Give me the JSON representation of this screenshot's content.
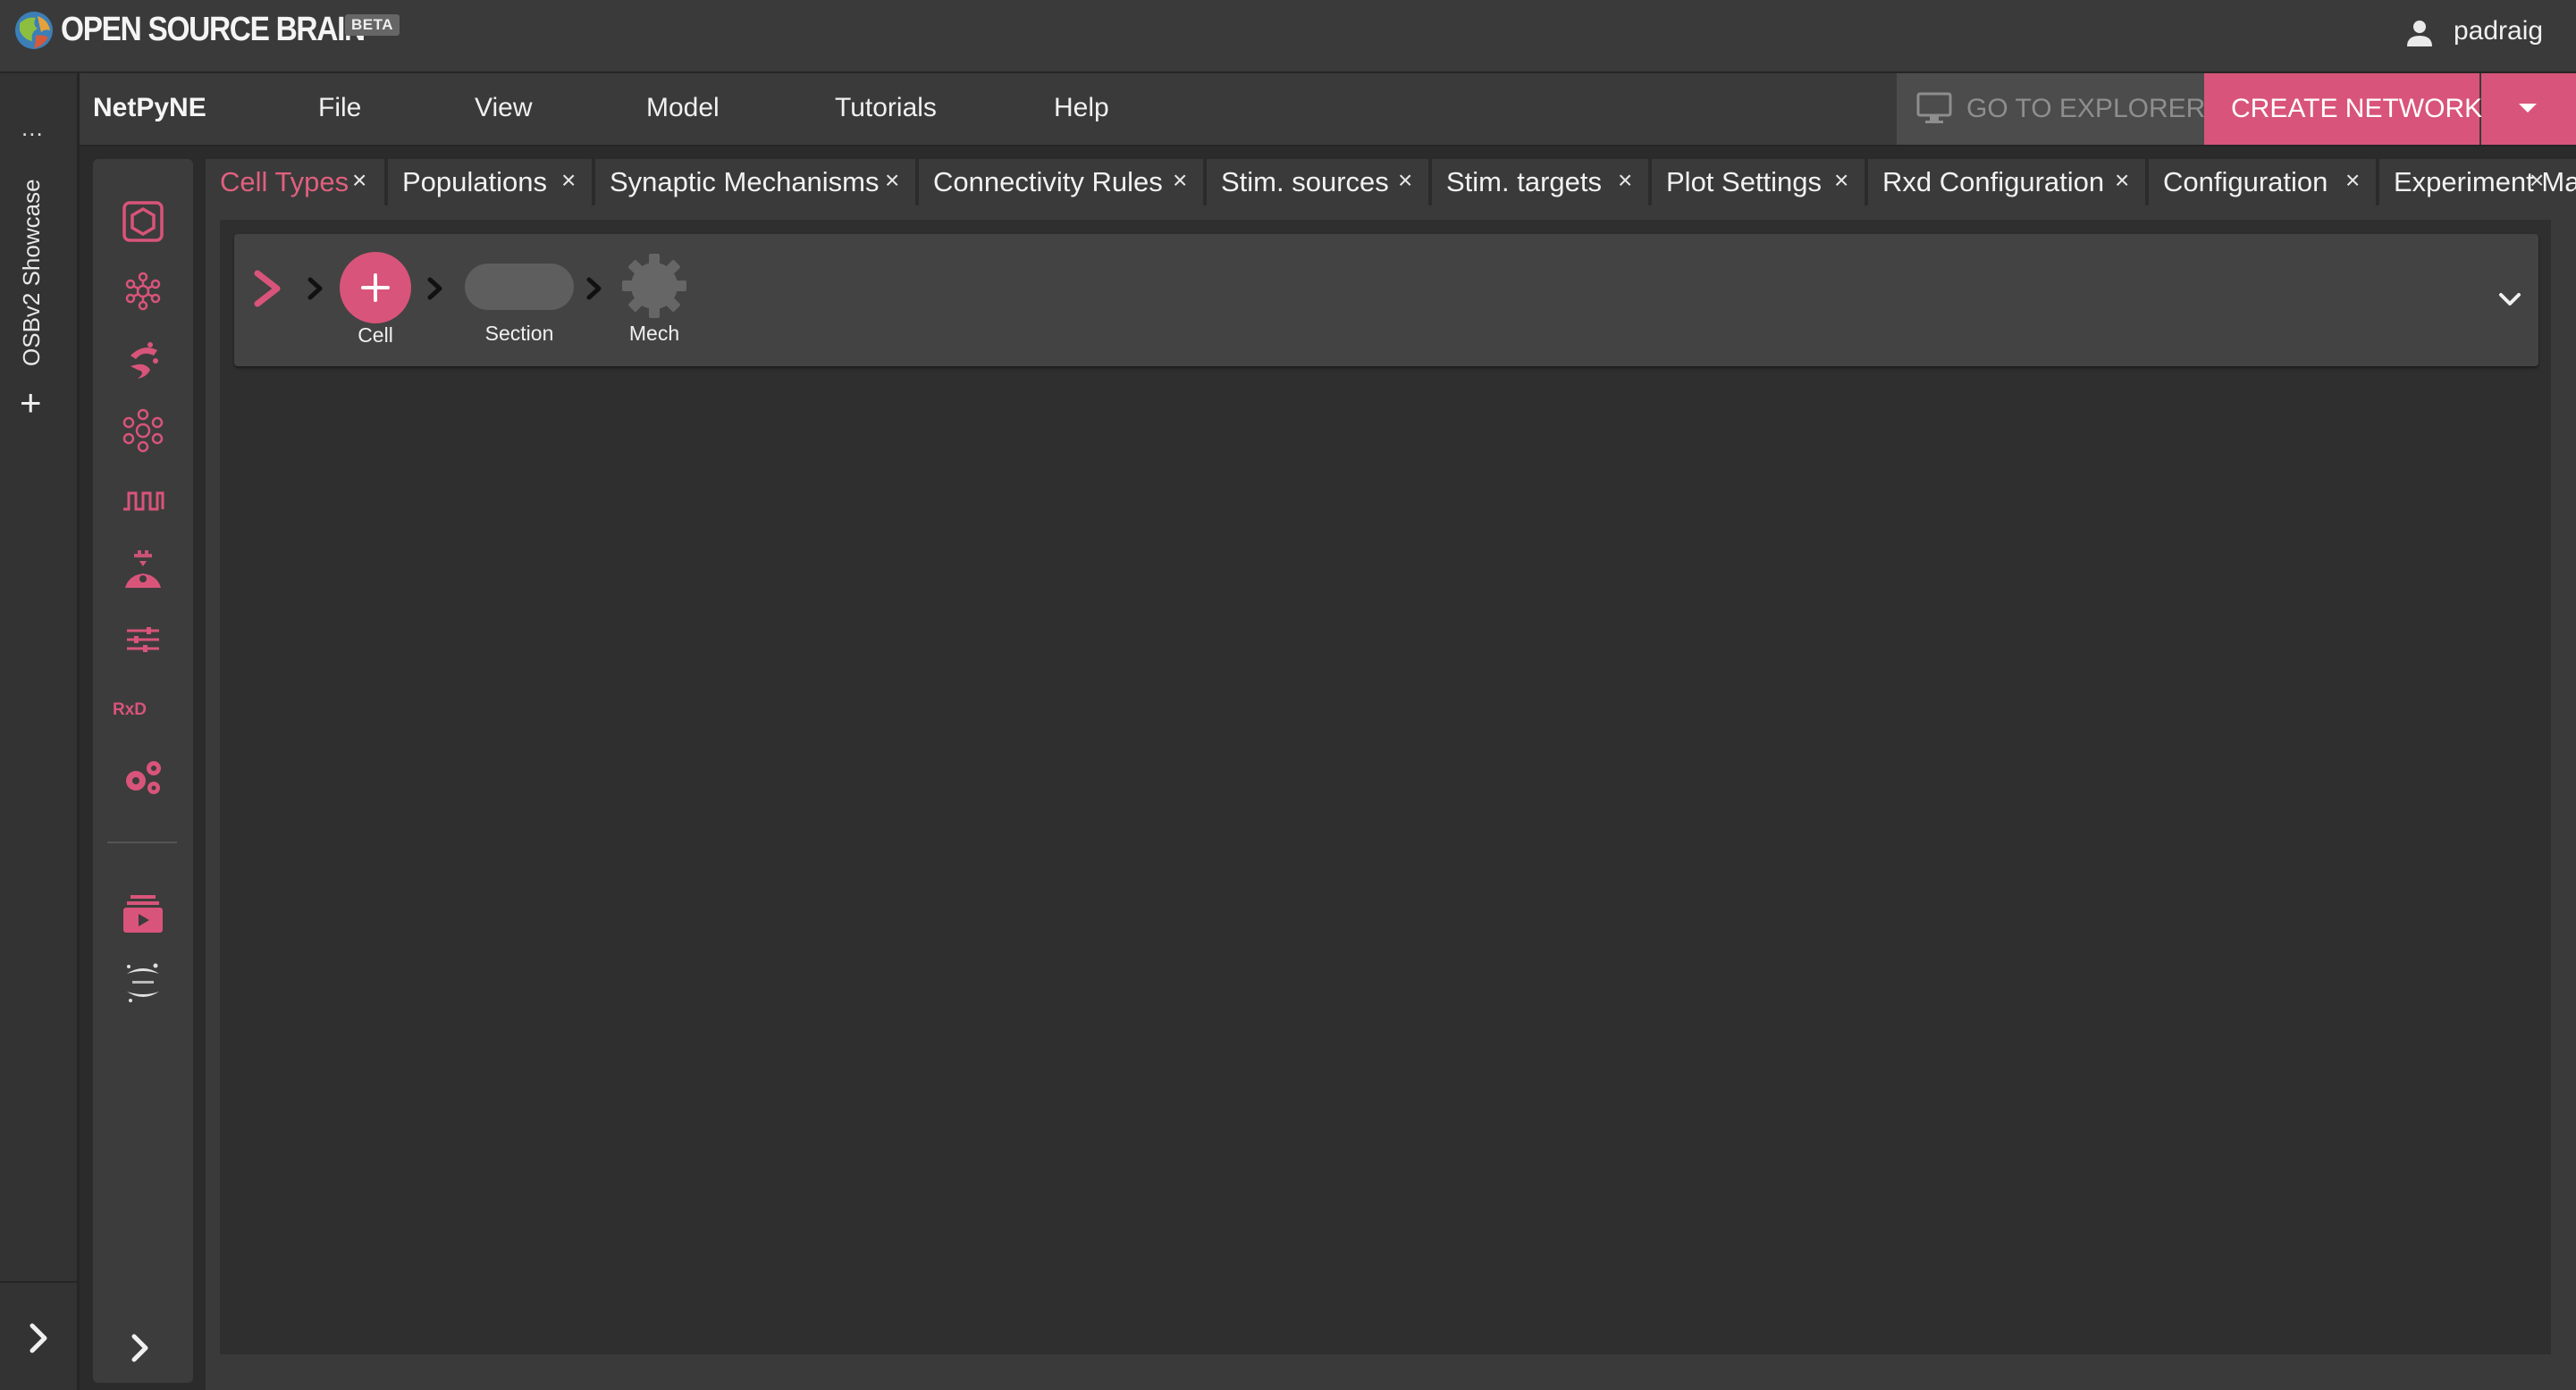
{
  "osb": {
    "brand": "OPEN SOURCE BRAIN",
    "beta": "BETA",
    "user": "padraig",
    "workspace": "OSBv2 Showcase",
    "ellipsis": "...",
    "add_label": "+"
  },
  "netpyne": {
    "app_name": "NetPyNE",
    "menu": [
      "File",
      "View",
      "Model",
      "Tutorials",
      "Help"
    ],
    "explorer_label": "GO TO EXPLORER",
    "create_label": "CREATE NETWORK"
  },
  "toolbar_icons": [
    "cell-types-icon",
    "populations-icon",
    "synaptic-mechanisms-icon",
    "connectivity-rules-icon",
    "stim-sources-icon",
    "stim-targets-icon",
    "plot-settings-icon",
    "rxd-icon",
    "configuration-icon",
    "experiments-icon",
    "jupyter-icon"
  ],
  "rxd_text": "RxD",
  "tabs": [
    {
      "label": "Cell Types",
      "active": true
    },
    {
      "label": "Populations"
    },
    {
      "label": "Synaptic Mechanisms"
    },
    {
      "label": "Connectivity Rules"
    },
    {
      "label": "Stim. sources"
    },
    {
      "label": "Stim. targets"
    },
    {
      "label": "Plot Settings"
    },
    {
      "label": "Rxd Configuration"
    },
    {
      "label": "Configuration"
    },
    {
      "label": "Experiment Ma"
    }
  ],
  "close_glyph": "×",
  "breadcrumb": {
    "cell_label": "Cell",
    "section_label": "Section",
    "mech_label": "Mech"
  },
  "colors": {
    "accent": "#d9547a",
    "bg_dark": "#2f2f2f",
    "panel": "#3a3a3a"
  }
}
